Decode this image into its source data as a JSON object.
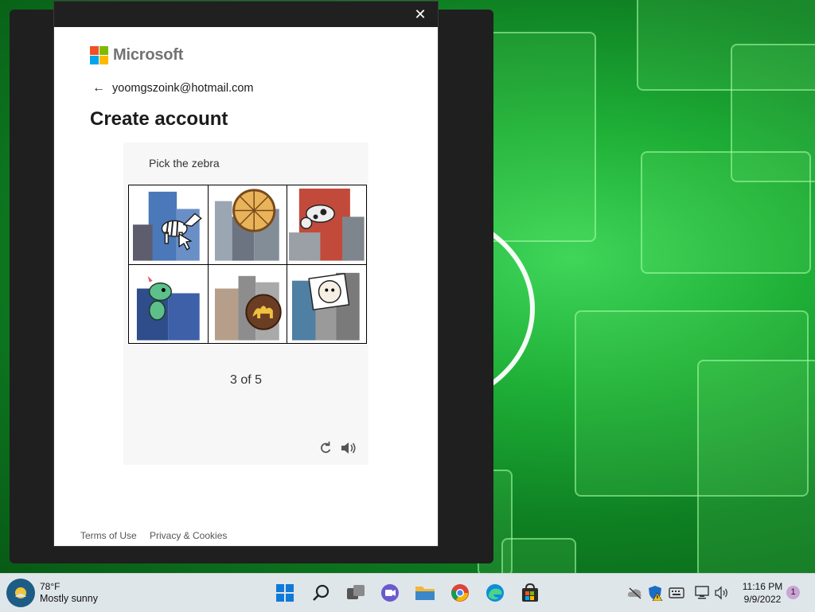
{
  "dialog": {
    "brand": "Microsoft",
    "email": "yoomgszoink@hotmail.com",
    "title": "Create account",
    "challenge": {
      "instruction": "Pick the zebra",
      "tiles": [
        "zebra",
        "pizza",
        "cow",
        "dinosaur",
        "camel",
        "sheep"
      ],
      "progress": "3 of 5"
    },
    "footer": {
      "terms": "Terms of Use",
      "privacy": "Privacy & Cookies"
    }
  },
  "taskbar": {
    "weather_temp": "78°F",
    "weather_desc": "Mostly sunny",
    "apps": [
      "start-icon",
      "search-icon",
      "task-view-icon",
      "chat-icon",
      "file-explorer-icon",
      "chrome-icon",
      "edge-icon",
      "store-icon"
    ],
    "time": "11:16 PM",
    "date": "9/9/2022",
    "notification_count": "1"
  },
  "colors": {
    "ms_red": "#f25022",
    "ms_green": "#7fba00",
    "ms_blue": "#00a4ef",
    "ms_yellow": "#ffb900"
  }
}
